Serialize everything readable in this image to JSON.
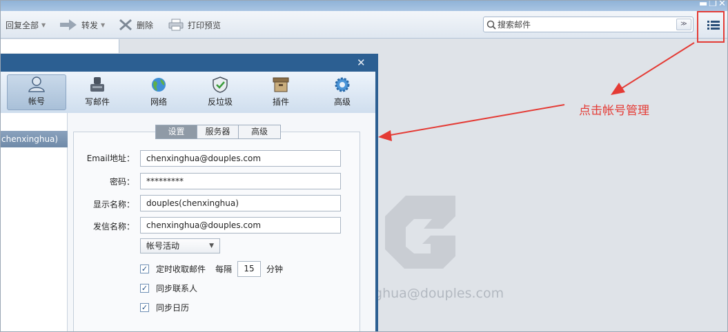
{
  "toolbar": {
    "reply_all": "回复全部",
    "forward": "转发",
    "delete": "删除",
    "print_preview": "打印预览"
  },
  "search": {
    "placeholder": "搜索邮件"
  },
  "watermark": {
    "email_partial": "nghua@douples.com"
  },
  "dialog": {
    "tabs": [
      {
        "label": "帐号",
        "icon": "person-icon"
      },
      {
        "label": "写邮件",
        "icon": "compose-icon"
      },
      {
        "label": "网络",
        "icon": "globe-icon"
      },
      {
        "label": "反垃圾",
        "icon": "shield-icon"
      },
      {
        "label": "插件",
        "icon": "box-icon"
      },
      {
        "label": "高级",
        "icon": "gear-icon"
      }
    ],
    "account_item": "chenxinghua)",
    "subtabs": [
      "设置",
      "服务器",
      "高级"
    ],
    "form": {
      "email_label": "Email地址：",
      "email_value": "chenxinghua@douples.com",
      "password_label": "密码：",
      "password_value": "*********",
      "display_name_label": "显示名称：",
      "display_name_value": "douples(chenxinghua)",
      "sender_name_label": "发信名称：",
      "sender_name_value": "chenxinghua@douples.com",
      "account_status": "帐号活动",
      "scheduled_fetch": "定时收取邮件",
      "every_label": "每隔",
      "interval_value": "15",
      "minute_label": "分钟",
      "sync_contacts": "同步联系人",
      "sync_calendar": "同步日历"
    }
  },
  "annotation": {
    "text": "点击帐号管理",
    "color": "#e43b35"
  },
  "colors": {
    "dialog_frame": "#2c5f92",
    "accent_red": "#e43b35"
  }
}
